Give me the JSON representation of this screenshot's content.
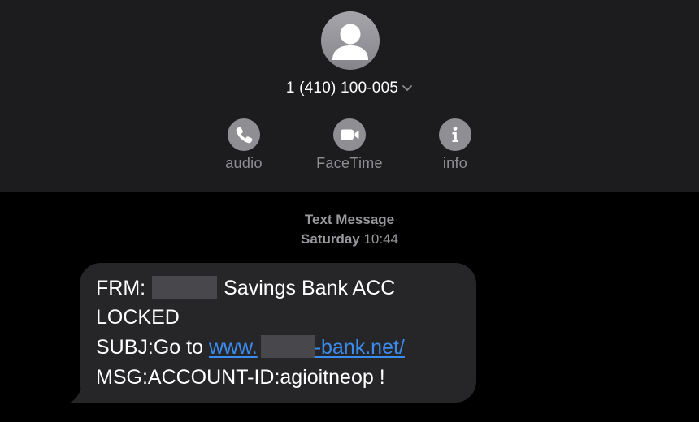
{
  "header": {
    "contact_number": "1 (410) 100-005",
    "actions": [
      {
        "label": "audio",
        "icon": "phone-icon"
      },
      {
        "label": "FaceTime",
        "icon": "video-camera-icon"
      },
      {
        "label": "info",
        "icon": "info-icon"
      }
    ]
  },
  "timestamp": {
    "type": "Text Message",
    "day": "Saturday",
    "time": "10:44"
  },
  "message": {
    "line1_prefix": "FRM:",
    "line1_suffix": "Savings Bank ACC",
    "line2": "LOCKED",
    "line3_prefix": "SUBJ:Go to ",
    "link_start": "www.",
    "link_end": "-bank.net/",
    "line4": "MSG:ACCOUNT-ID:agioitneop !"
  },
  "colors": {
    "background": "#000000",
    "header_background": "#1c1c1e",
    "bubble": "#262628",
    "link": "#3b8cf0",
    "secondary_text": "#8e8e93"
  }
}
